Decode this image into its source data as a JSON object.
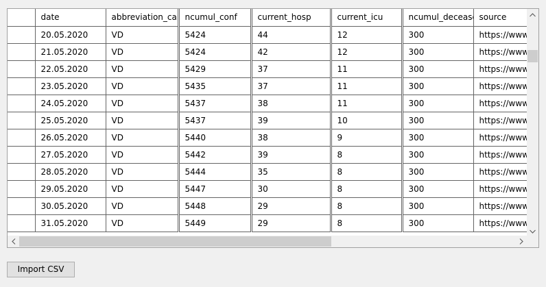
{
  "table": {
    "columns": [
      "date",
      "abbreviation_canton",
      "ncumul_conf",
      "current_hosp",
      "current_icu",
      "ncumul_deceased",
      "source"
    ],
    "rows": [
      [
        "20.05.2020",
        "VD",
        "5424",
        "44",
        "12",
        "300",
        "https://www.v"
      ],
      [
        "21.05.2020",
        "VD",
        "5424",
        "42",
        "12",
        "300",
        "https://www.v"
      ],
      [
        "22.05.2020",
        "VD",
        "5429",
        "37",
        "11",
        "300",
        "https://www.v"
      ],
      [
        "23.05.2020",
        "VD",
        "5435",
        "37",
        "11",
        "300",
        "https://www.v"
      ],
      [
        "24.05.2020",
        "VD",
        "5437",
        "38",
        "11",
        "300",
        "https://www.v"
      ],
      [
        "25.05.2020",
        "VD",
        "5437",
        "39",
        "10",
        "300",
        "https://www.v"
      ],
      [
        "26.05.2020",
        "VD",
        "5440",
        "38",
        "9",
        "300",
        "https://www.v"
      ],
      [
        "27.05.2020",
        "VD",
        "5442",
        "39",
        "8",
        "300",
        "https://www.v"
      ],
      [
        "28.05.2020",
        "VD",
        "5444",
        "35",
        "8",
        "300",
        "https://www.v"
      ],
      [
        "29.05.2020",
        "VD",
        "5447",
        "30",
        "8",
        "300",
        "https://www.v"
      ],
      [
        "30.05.2020",
        "VD",
        "5448",
        "29",
        "8",
        "300",
        "https://www.v"
      ],
      [
        "31.05.2020",
        "VD",
        "5449",
        "29",
        "8",
        "300",
        "https://www.v"
      ]
    ]
  },
  "buttons": {
    "import_label": "Import CSV"
  },
  "icons": {
    "scroll_up": "chevron-up-icon",
    "scroll_down": "chevron-down-icon",
    "scroll_left": "chevron-left-icon",
    "scroll_right": "chevron-right-icon"
  }
}
